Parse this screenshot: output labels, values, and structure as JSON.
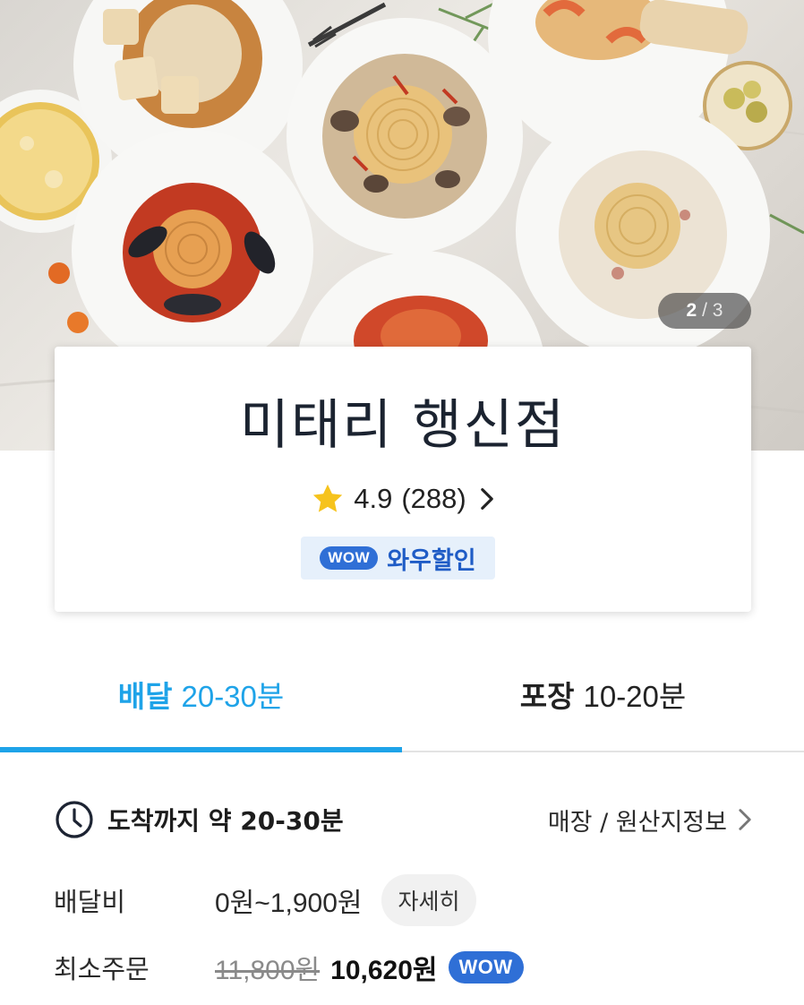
{
  "hero": {
    "image_description": "Overhead photo of several plates of pasta and pizza on a light marble table",
    "counter": {
      "current": "2",
      "separator": " / ",
      "total": "3"
    }
  },
  "store": {
    "name": "미태리 행신점",
    "rating": "4.9",
    "review_count": "(288)",
    "wow_badge": {
      "pill": "WOW",
      "label": "와우할인"
    }
  },
  "tabs": [
    {
      "label": "배달",
      "time": "20-30분",
      "active": true
    },
    {
      "label": "포장",
      "time": "10-20분",
      "active": false
    }
  ],
  "info": {
    "arrival_text": "도착까지 약 20-30분",
    "store_info_link": "매장 / 원산지정보",
    "delivery_fee": {
      "label": "배달비",
      "value": "0원~1,900원",
      "detail_button": "자세히"
    },
    "min_order": {
      "label": "최소주문",
      "original_price": "11,800원",
      "discount_price": "10,620원",
      "pill": "WOW"
    }
  },
  "colors": {
    "accent_blue": "#1ea3e8",
    "wow_blue": "#2f6fd6",
    "star_yellow": "#f6c31c"
  },
  "icons": [
    "star-icon",
    "chevron-right-icon",
    "clock-icon"
  ]
}
